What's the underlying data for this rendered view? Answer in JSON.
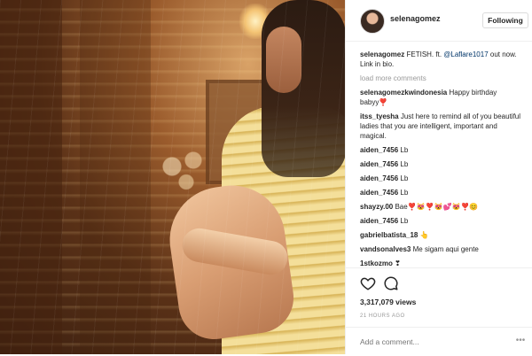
{
  "post": {
    "username": "selenagomez",
    "follow_label": "Following",
    "caption_user": "selenagomez",
    "caption_text": "FETISH. ft. ",
    "caption_mention": "@Laflare1017",
    "caption_tail": " out now. Link in bio.",
    "load_more": "load more comments",
    "comments": [
      {
        "user": "selenagomezkwindonesia",
        "text": "Happy birthday babyy❣️"
      },
      {
        "user": "itss_tyesha",
        "text": "Just here to remind all of you beautiful ladies that you are intelligent, important and magical."
      },
      {
        "user": "aiden_7456",
        "text": "Lb"
      },
      {
        "user": "aiden_7456",
        "text": "Lb"
      },
      {
        "user": "aiden_7456",
        "text": "Lb"
      },
      {
        "user": "aiden_7456",
        "text": "Lb"
      },
      {
        "user": "shayzy.00",
        "text": "Bae❣️😻❣️😻💕😻❣️😊"
      },
      {
        "user": "aiden_7456",
        "text": "Lb"
      },
      {
        "user": "gabrielbatista_18",
        "text": "👆"
      },
      {
        "user": "vandsonalves3",
        "text": "Me sigam aqui gente"
      },
      {
        "user": "1stkozmo",
        "text": "❣"
      }
    ],
    "likes": "3,317,079 views",
    "time_ago": "21 HOURS AGO",
    "add_comment_placeholder": "Add a comment...",
    "more_icon_glyph": "•••"
  },
  "icons": {
    "like": "heart-icon",
    "comment": "speech-bubble-icon",
    "more": "more-options-icon"
  },
  "colors": {
    "text": "#262626",
    "muted": "#999999",
    "link": "#003569",
    "border": "#efefef"
  }
}
